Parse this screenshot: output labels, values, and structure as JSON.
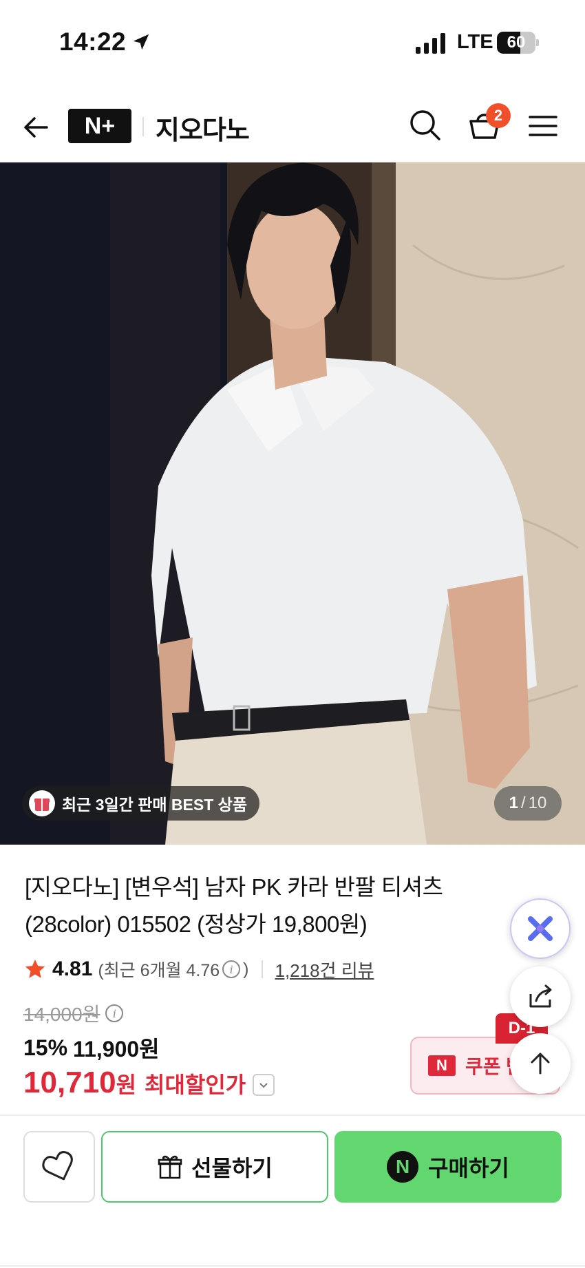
{
  "status_bar": {
    "time": "14:22",
    "network": "LTE",
    "battery": "60",
    "battery_level": 0.6
  },
  "header": {
    "logo_text": "N+",
    "brand": "지오다노",
    "cart_count": "2",
    "icons": [
      "back-arrow-icon",
      "search-icon",
      "cart-icon",
      "menu-icon"
    ]
  },
  "hero": {
    "badge": "최근 3일간 판매 BEST 상품",
    "counter_current": "1",
    "counter_separator": "/",
    "counter_total": "10"
  },
  "product": {
    "title_line1": "[지오다노] [변우석] 남자 PK 카라 반팔 티셔츠",
    "title_line2": "(28color) 015502 (정상가 19,800원)",
    "rating": "4.81",
    "recent_rating": "(최근 6개월 4.76",
    "recent_rating_close": ")",
    "review_count": "1,218건 리뷰",
    "original_price": "14,000원",
    "discount_rate": "15%",
    "sale_price": "11,900원",
    "final_price": "10,710",
    "final_unit": "원",
    "final_label": "최대할인가"
  },
  "coupon": {
    "badge": "D-1",
    "logo": "N",
    "label": "쿠폰 받"
  },
  "bottom_bar": {
    "gift_label": "선물하기",
    "buy_label": "구매하기",
    "npay_logo": "N"
  },
  "colors": {
    "accent_red": "#e0283b",
    "npay_green": "#62d66f",
    "cart_badge": "#f04f2a"
  }
}
